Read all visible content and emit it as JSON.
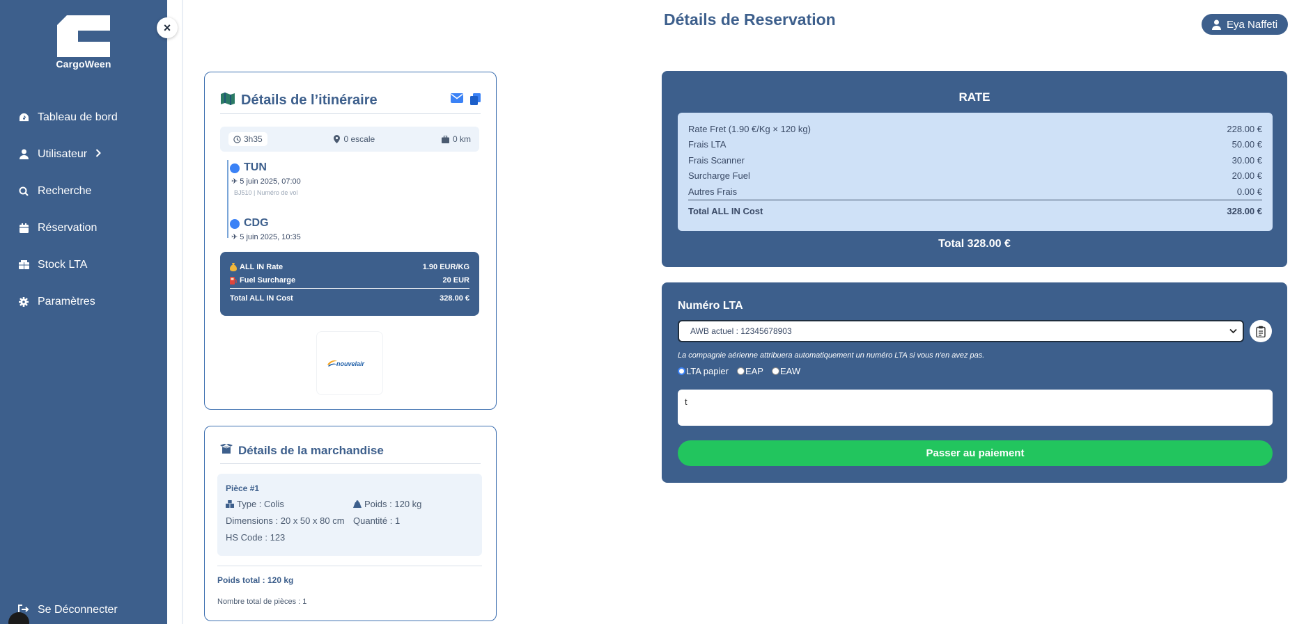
{
  "sidebar": {
    "brand": "CargoWeen",
    "items": [
      {
        "label": "Tableau de bord",
        "icon": "dashboard-icon"
      },
      {
        "label": "Utilisateur",
        "icon": "user-icon"
      },
      {
        "label": "Recherche",
        "icon": "search-icon"
      },
      {
        "label": "Réservation",
        "icon": "calendar-icon"
      },
      {
        "label": "Stock LTA",
        "icon": "boxes-icon"
      },
      {
        "label": "Paramètres",
        "icon": "gear-icon"
      }
    ],
    "logout": "Se Déconnecter",
    "close_symbol": "×"
  },
  "header": {
    "title": "Détails de Reservation",
    "user": "Eya Naffeti"
  },
  "itinerary": {
    "title": "Détails de l’itinéraire",
    "duration": "3h35",
    "stops": "0 escale",
    "distance": "0 km",
    "departure": {
      "code": "TUN",
      "datetime": "5 juin 2025, 07:00",
      "flight": "BJ510 | Numéro de vol"
    },
    "arrival": {
      "code": "CDG",
      "datetime": "5 juin 2025, 10:35"
    },
    "all_in_rate_label": "ALL IN Rate",
    "all_in_rate_value": "1.90 EUR/KG",
    "fuel_label": "Fuel Surcharge",
    "fuel_value": "20 EUR",
    "total_label": "Total ALL IN Cost",
    "total_value": "328.00 €",
    "airline": "nouvelair"
  },
  "goods": {
    "title": "Détails de la marchandise",
    "piece_title": "Pièce #1",
    "type": "Type : Colis",
    "weight": "Poids : 120 kg",
    "dimensions": "Dimensions : 20 x 50 x 80 cm",
    "quantity": "Quantité : 1",
    "hs_code": "HS Code : 123",
    "total_weight": "Poids total : 120 kg",
    "total_pieces": "Nombre total de pièces : 1"
  },
  "rate": {
    "title": "RATE",
    "rows": [
      {
        "label": "Rate Fret (1.90 €/Kg × 120 kg)",
        "value": "228.00 €"
      },
      {
        "label": "Frais LTA",
        "value": "50.00 €"
      },
      {
        "label": "Frais Scanner",
        "value": "30.00 €"
      },
      {
        "label": "Surcharge Fuel",
        "value": "20.00 €"
      },
      {
        "label": "Autres Frais",
        "value": "0.00 €"
      }
    ],
    "total_label": "Total ALL IN Cost",
    "total_value": "328.00 €",
    "grand_total": "Total 328.00 €"
  },
  "lta": {
    "title": "Numéro LTA",
    "selected": "AWB actuel : 12345678903",
    "note": "La compagnie aérienne attribuera automatiquement un numéro LTA si vous n'en avez pas.",
    "options": [
      {
        "label": "LTA papier",
        "checked": true
      },
      {
        "label": "EAP",
        "checked": false
      },
      {
        "label": "EAW",
        "checked": false
      }
    ],
    "comment": "t",
    "pay_button": "Passer au paiement"
  },
  "colors": {
    "primary": "#3d5f8c",
    "light_panel": "#cfe1f7",
    "pay": "#22c55e",
    "accent": "#3b82f6"
  }
}
